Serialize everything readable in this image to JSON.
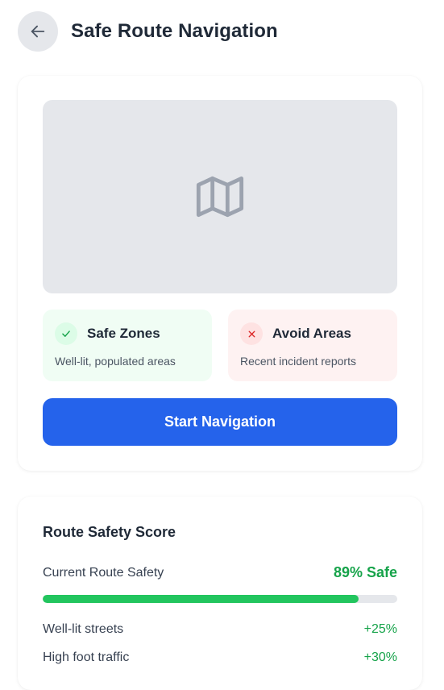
{
  "header": {
    "title": "Safe Route Navigation",
    "back_icon": "arrow-left-icon"
  },
  "map": {
    "icon": "map-icon",
    "colors": {
      "background": "#e5e7eb",
      "icon": "#9ca3af"
    }
  },
  "legend": {
    "safe": {
      "icon": "check-icon",
      "title": "Safe Zones",
      "description": "Well-lit, populated areas",
      "color": "#16a34a"
    },
    "avoid": {
      "icon": "x-icon",
      "title": "Avoid Areas",
      "description": "Recent incident reports",
      "color": "#dc2626"
    }
  },
  "start_button": {
    "label": "Start Navigation",
    "color": "#2563eb"
  },
  "safety_score": {
    "title": "Route Safety Score",
    "current_label": "Current Route Safety",
    "current_value": "89% Safe",
    "progress_percent": 89,
    "progress_color": "#22c55e",
    "factors": [
      {
        "label": "Well-lit streets",
        "value": "+25%"
      },
      {
        "label": "High foot traffic",
        "value": "+30%"
      }
    ]
  }
}
